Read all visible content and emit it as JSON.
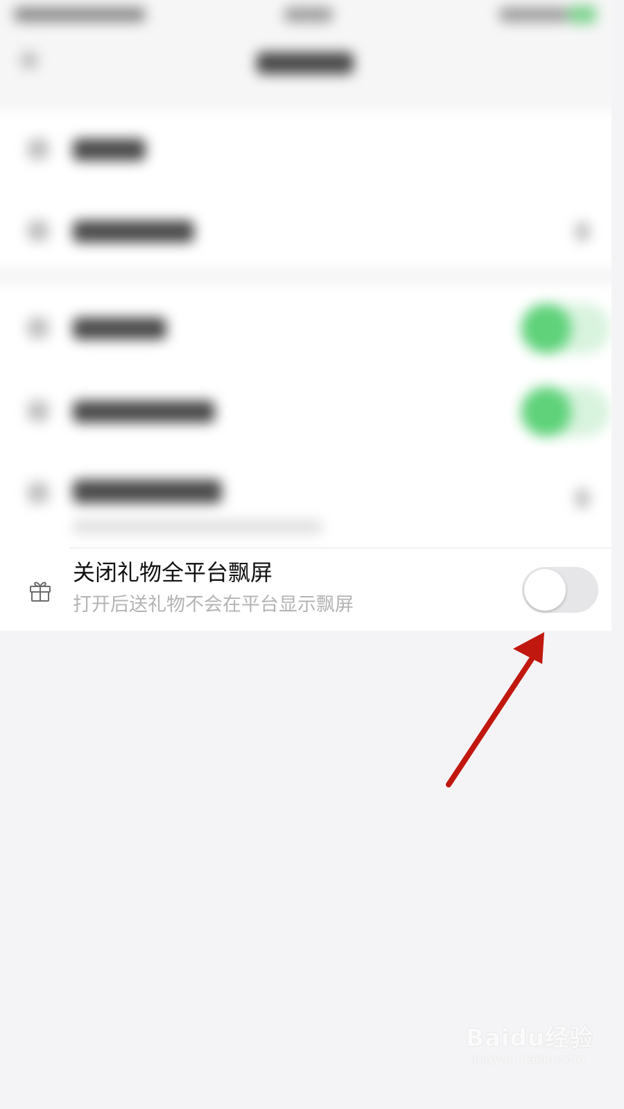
{
  "setting": {
    "title": "关闭礼物全平台飘屏",
    "subtitle": "打开后送礼物不会在平台显示飘屏",
    "toggle_on": false,
    "icon": "gift-icon"
  },
  "annotation": {
    "arrow_color": "#c0180f"
  },
  "watermark": {
    "logo": "Baidu经验",
    "url": "jingyan.baidu.com"
  },
  "colors": {
    "background": "#f4f4f6",
    "toggle_track": "#e6e6e8",
    "accent_green": "#5fd27a"
  }
}
